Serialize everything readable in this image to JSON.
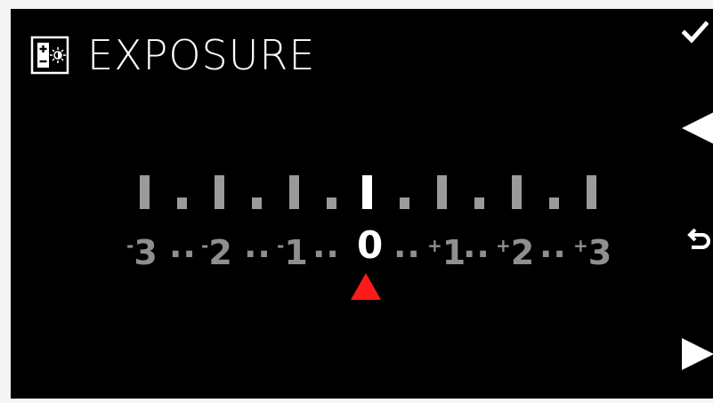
{
  "screen": {
    "title": "EXPOSURE",
    "icon": "exposure-compensation-icon"
  },
  "scale": {
    "labels": [
      "-3",
      "-2",
      "-1",
      "0",
      "+1",
      "+2",
      "+3"
    ],
    "label_signs": [
      "-",
      "-",
      "-",
      "",
      "+",
      "+",
      "+"
    ],
    "label_digits": [
      "3",
      "2",
      "1",
      "0",
      "1",
      "2",
      "3"
    ],
    "separator": "..",
    "selected_value": "0",
    "pointer_color": "#ff1a1a"
  },
  "side_buttons": {
    "confirm": "check-icon",
    "left": "left-arrow-icon",
    "back": "return-icon",
    "right": "right-arrow-icon"
  },
  "colors": {
    "background": "#000000",
    "text": "#ffffff",
    "inactive": "#9a9a9a",
    "accent": "#ff1a1a"
  }
}
